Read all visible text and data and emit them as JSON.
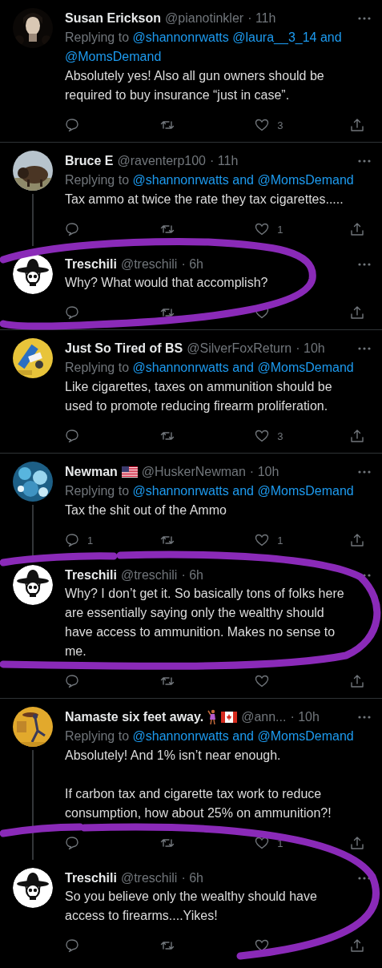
{
  "groups": [
    {
      "tweets": [
        {
          "avatar": {
            "kind": "picture"
          },
          "name": "Susan Erickson",
          "handle": "@pianotinkler",
          "time": "· 11h",
          "replying": {
            "label": "Replying to",
            "mentions": [
              "@shannonrwatts",
              "@laura__3_14 and",
              "@MomsDemand"
            ]
          },
          "body": [
            "Absolutely yes! Also all gun owners should be required to buy insurance “just in case”."
          ],
          "like_count": "3"
        }
      ]
    },
    {
      "tweets": [
        {
          "avatar": {
            "kind": "picture"
          },
          "name": "Bruce E",
          "handle": "@raventerp100",
          "time": "· 11h",
          "replying": {
            "label": "Replying to",
            "mentions": [
              "@shannonrwatts and",
              "@MomsDemand"
            ]
          },
          "body": [
            "Tax ammo at twice the rate they tax cigarettes....."
          ],
          "like_count": "1"
        },
        {
          "avatar": {
            "kind": "emblem"
          },
          "name": "Treschili",
          "handle": "@treschili",
          "time": "· 6h",
          "body": [
            "Why? What would that accomplish?"
          ]
        }
      ],
      "annotation": {
        "kind": "loop"
      }
    },
    {
      "tweets": [
        {
          "avatar": {
            "kind": "picture"
          },
          "name": "Just So Tired of BS",
          "handle": "@SilverFoxReturn",
          "time": "· 10h",
          "replying": {
            "label": "Replying to",
            "mentions": [
              "@shannonrwatts and",
              "@MomsDemand"
            ]
          },
          "body": [
            "Like cigarettes, taxes on ammunition should be used to promote reducing firearm proliferation."
          ],
          "like_count": "3"
        }
      ]
    },
    {
      "tweets": [
        {
          "avatar": {
            "kind": "picture"
          },
          "name": "Newman",
          "badges": [
            {
              "kind": "us-flag"
            }
          ],
          "handle": "@HuskerNewman",
          "time": "· 10h",
          "replying": {
            "label": "Replying to",
            "mentions": [
              "@shannonrwatts and",
              "@MomsDemand"
            ]
          },
          "body": [
            "Tax the shit out of the Ammo"
          ],
          "reply_count": "1",
          "like_count": "1"
        },
        {
          "avatar": {
            "kind": "emblem"
          },
          "name": "Treschili",
          "handle": "@treschili",
          "time": "· 6h",
          "body": [
            "Why? I don’t get it. So basically tons of folks here are essentially saying only the wealthy should have access to ammunition. Makes no sense to me."
          ]
        }
      ],
      "annotation": {
        "kind": "wide-loop"
      }
    },
    {
      "tweets": [
        {
          "avatar": {
            "kind": "picture"
          },
          "name": "Namaste six feet away.",
          "badges": [
            {
              "kind": "dancer"
            },
            {
              "kind": "canada-flag"
            }
          ],
          "handle": "@ann...",
          "time": "· 10h",
          "replying": {
            "label": "Replying to",
            "mentions": [
              "@shannonrwatts and",
              "@MomsDemand"
            ]
          },
          "body": [
            "Absolutely! And 1% isn’t near enough.",
            "If carbon tax and cigarette tax work to reduce consumption, how about 25% on ammunition?!"
          ],
          "like_count": "1"
        },
        {
          "avatar": {
            "kind": "emblem"
          },
          "name": "Treschili",
          "handle": "@treschili",
          "time": "· 6h",
          "body": [
            "So you believe only the wealthy should have access to firearms....Yikes!"
          ]
        }
      ],
      "annotation": {
        "kind": "open"
      }
    }
  ]
}
